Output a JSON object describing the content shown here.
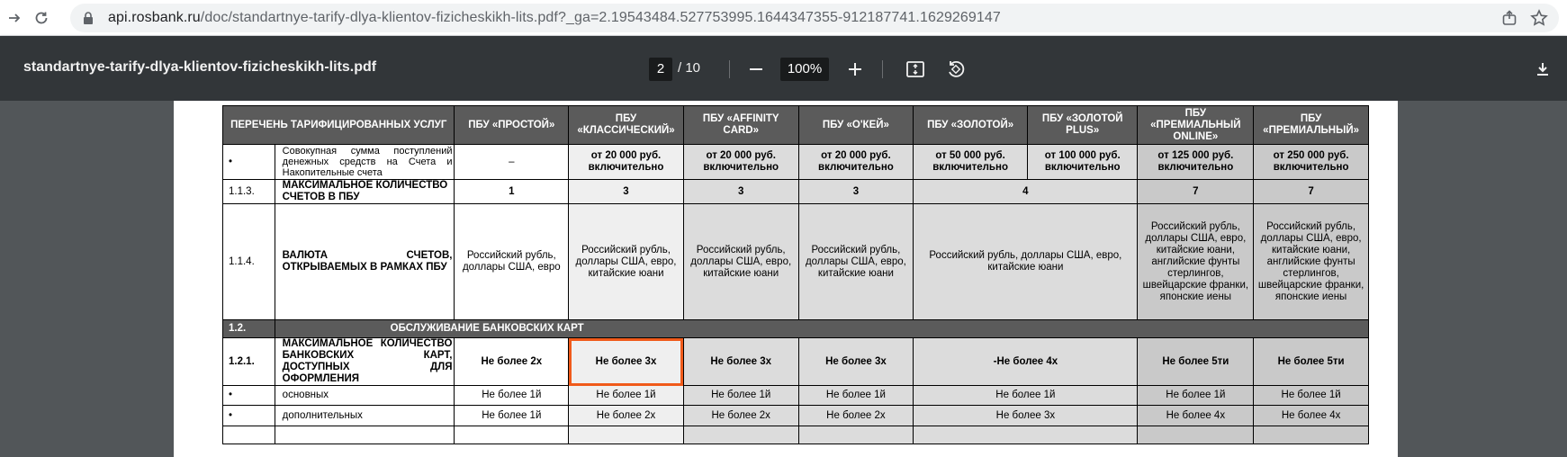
{
  "browser": {
    "url_host": "api.rosbank.ru",
    "url_path": "/doc/standartnye-tarify-dlya-klientov-fizicheskikh-lits.pdf?_ga=2.19543484.527753995.1644347355-912187741.1629269147"
  },
  "viewer": {
    "title": "standartnye-tarify-dlya-klientov-fizicheskikh-lits.pdf",
    "page_current": "2",
    "page_total": "/ 10",
    "zoom": "100%"
  },
  "table": {
    "headers": [
      "ПЕРЕЧЕНЬ ТАРИФИЦИРОВАННЫХ УСЛУГ",
      "ПБУ «ПРОСТОЙ»",
      "ПБУ «КЛАССИЧЕСКИЙ»",
      "ПБУ «AFFINITY CARD»",
      "ПБУ «О'КЕЙ»",
      "ПБУ «ЗОЛОТОЙ»",
      "ПБУ «ЗОЛОТОЙ PLUS»",
      "ПБУ «ПРЕМИАЛЬНЫЙ ONLINE»",
      "ПБУ «ПРЕМИАЛЬНЫЙ»"
    ],
    "row_income": {
      "num": "•",
      "name": "Совокупная сумма поступлений денежных средств на Счета и Накопительные счета",
      "values": [
        "–",
        "от 20 000 руб. включительно",
        "от 20 000 руб. включительно",
        "от 20 000 руб. включительно",
        "от 50 000 руб. включительно",
        "от 100 000 руб. включительно",
        "от 125 000 руб. включительно",
        "от 250 000 руб. включительно"
      ]
    },
    "row_113": {
      "num": "1.1.3.",
      "name": "МАКСИМАЛЬНОЕ КОЛИЧЕСТВО СЧЕТОВ В ПБУ",
      "values": [
        "1",
        "3",
        "3",
        "3",
        "4",
        "7",
        "7"
      ]
    },
    "row_114": {
      "num": "1.1.4.",
      "name": "ВАЛЮТА СЧЕТОВ, ОТКРЫВАЕМЫХ В РАМКАХ ПБУ",
      "values": [
        "Российский рубль, доллары США, евро",
        "Российский рубль, доллары США, евро, китайские юани",
        "Российский рубль, доллары США, евро, китайские юани",
        "Российский рубль, доллары США, евро, китайские юани",
        "Российский рубль, доллары США, евро, китайские юани",
        "Российский рубль, доллары США, евро, китайские юани, английские фунты стерлингов, швейцарские франки, японские иены",
        "Российский рубль, доллары США, евро, китайские юани, английские фунты стерлингов, швейцарские франки, японские иены"
      ]
    },
    "section_12": {
      "num": "1.2.",
      "title": "ОБСЛУЖИВАНИЕ БАНКОВСКИХ КАРТ"
    },
    "row_121": {
      "num": "1.2.1.",
      "name": "МАКСИМАЛЬНОЕ КОЛИЧЕСТВО БАНКОВСКИХ КАРТ, ДОСТУПНЫХ ДЛЯ ОФОРМЛЕНИЯ",
      "values": [
        "Не более 2х",
        "Не более 3х",
        "Не более 3х",
        "Не более 3х",
        "-Не более 4х",
        "Не более 5ти",
        "Не более 5ти"
      ]
    },
    "row_main": {
      "num": "•",
      "name": "основных",
      "values": [
        "Не более 1й",
        "Не более 1й",
        "Не более 1й",
        "Не более 1й",
        "Не более 1й",
        "Не более 1й",
        "Не более 1й"
      ]
    },
    "row_extra": {
      "num": "•",
      "name": "дополнительных",
      "values": [
        "Не более 1й",
        "Не более 2х",
        "Не более 2х",
        "Не более 2х",
        "Не более 3х",
        "Не более 4х",
        "Не более 4х"
      ]
    }
  }
}
